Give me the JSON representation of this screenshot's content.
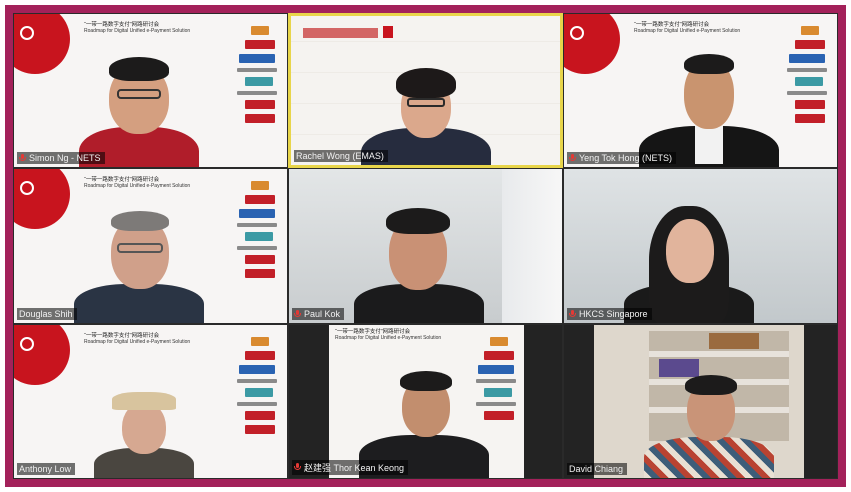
{
  "meeting": {
    "participants": [
      {
        "name": "Simon Ng - NETS",
        "muted": true,
        "speaking": false,
        "background": "slide"
      },
      {
        "name": "Rachel Wong (EMAS)",
        "muted": false,
        "speaking": true,
        "background": "slide"
      },
      {
        "name": "Yeng Tok Hong (NETS)",
        "muted": true,
        "speaking": false,
        "background": "slide"
      },
      {
        "name": "Douglas Shih",
        "muted": false,
        "speaking": false,
        "background": "slide"
      },
      {
        "name": "Paul Kok",
        "muted": true,
        "speaking": false,
        "background": "room"
      },
      {
        "name": "HKCS Singapore",
        "muted": true,
        "speaking": false,
        "background": "room"
      },
      {
        "name": "Anthony Low",
        "muted": false,
        "speaking": false,
        "background": "slide"
      },
      {
        "name": "赵建强 Thor Kean Keong",
        "muted": true,
        "speaking": false,
        "background": "slide"
      },
      {
        "name": "David Chiang",
        "muted": false,
        "speaking": false,
        "background": "shelf"
      }
    ]
  },
  "slide": {
    "title_cn": "“一带一路数字支付”网路研讨会",
    "title_en": "Roadmap for Digital Unified e-Payment Solution"
  },
  "colors": {
    "frame": "#a3215a",
    "active_border": "#e8d54a",
    "slide_red": "#c8141e",
    "muted_icon": "#e53935"
  }
}
